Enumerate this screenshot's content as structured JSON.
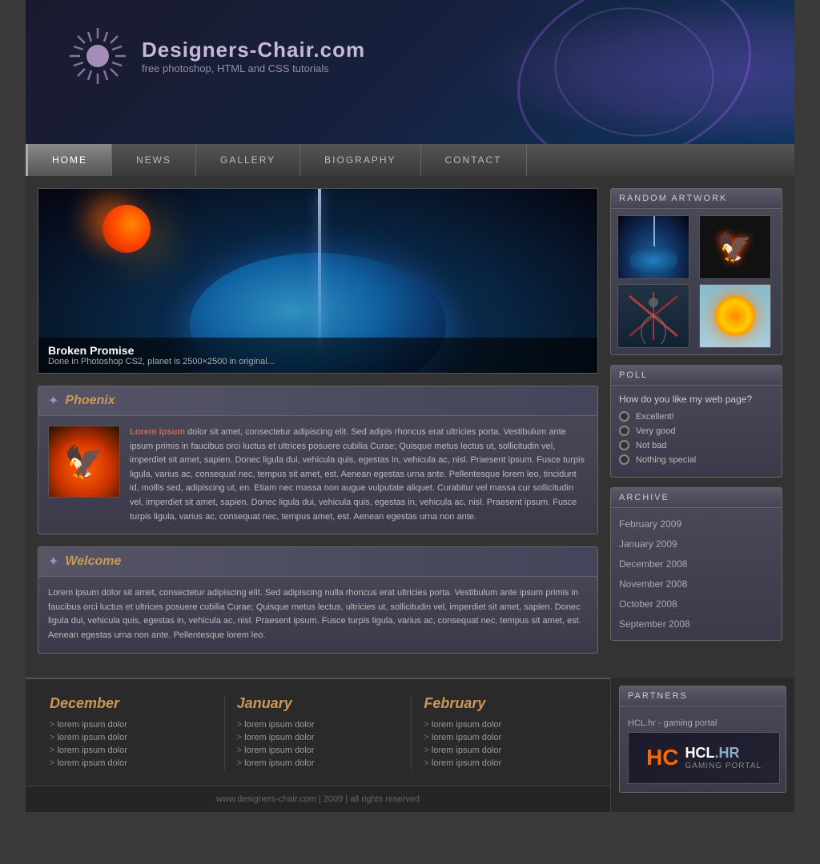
{
  "site": {
    "title": "Designers-Chair.com",
    "subtitle": "free photoshop, HTML and CSS tutorials"
  },
  "nav": {
    "items": [
      {
        "label": "HOME",
        "active": true
      },
      {
        "label": "NEWS",
        "active": false
      },
      {
        "label": "GALLERY",
        "active": false
      },
      {
        "label": "BIOGRAPHY",
        "active": false
      },
      {
        "label": "CONTACT",
        "active": false
      }
    ]
  },
  "featured": {
    "title": "Broken Promise",
    "caption": "Done in Photoshop CS2, planet is 2500×2500 in original..."
  },
  "posts": [
    {
      "title": "Phoenix",
      "lorem_title": "Lorem ipsum",
      "body": "dolor sit amet, consectetur adipiscing elit. Sed adipis rhoncus erat ultricies porta. Vestibulum ante ipsum primis in faucibus orci luctus et ultrices posuere cubilia Curae; Quisque metus lectus ut, sollicitudin vel, imperdiet sit amet, sapien. Donec ligula dui, vehicula quis, egestas in, vehicula ac, nisl. Praesent ipsum. Fusce turpis ligula, varius ac, consequat nec, tempus sit amet, est. Aenean egestas urna ante. Pellentesque lorem leo, tincidunt id, mollis sed, adipiscing ut, en. Etiam nec massa non augue vulputate aliquet. Curabitur vel massa cur sollicitudin vel, imperdiet sit amet, sapien. Donec ligula dui, vehicula quis, egestas in, vehicula ac, nisl. Praesent ipsum. Fusce turpis ligula, varius ac, consequat nec, tempus amet, est. Aenean egestas urna non ante."
    },
    {
      "title": "Welcome",
      "lorem_title": "Lorem ipsum",
      "body": "dolor sit amet, consectetur adipiscing elit. Sed adipiscing nulla rhoncus erat ultricies porta. Vestibulum ante ipsum primis in faucibus orci luctus et ultrices posuere cubilia Curae; Quisque metus lectus, ultricies ut, sollicitudin vel, imperdiet sit amet, sapien. Donec ligula dui, vehicula quis, egestas in, vehicula ac, nisl. Praesent ipsum. Fusce turpis ligula, varius ac, consequat nec, tempus sit amet, est. Aenean egestas urna non ante. Pellentesque lorem leo."
    }
  ],
  "sidebar": {
    "artwork_title": "RANDOM ARTWORK",
    "poll_title": "POLL",
    "poll_question": "How do you like my web page?",
    "poll_options": [
      {
        "label": "Excellent!"
      },
      {
        "label": "Very good"
      },
      {
        "label": "Not bad"
      },
      {
        "label": "Nothing special"
      }
    ],
    "archive_title": "ARCHIVE",
    "archive_items": [
      {
        "label": "February 2009"
      },
      {
        "label": "January 2009"
      },
      {
        "label": "December 2008"
      },
      {
        "label": "November 2008"
      },
      {
        "label": "October 2008"
      },
      {
        "label": "September 2008"
      }
    ]
  },
  "footer": {
    "cols": [
      {
        "title": "December",
        "links": [
          "lorem ipsum dolor",
          "lorem ipsum dolor",
          "lorem ipsum dolor",
          "lorem ipsum dolor"
        ]
      },
      {
        "title": "January",
        "links": [
          "lorem ipsum dolor",
          "lorem ipsum dolor",
          "lorem ipsum dolor",
          "lorem ipsum dolor"
        ]
      },
      {
        "title": "February",
        "links": [
          "lorem ipsum dolor",
          "lorem ipsum dolor",
          "lorem ipsum dolor",
          "lorem ipsum dolor"
        ]
      }
    ],
    "partners_title": "PARTNERS",
    "partners_link": "HCL.hr - gaming portal",
    "copyright": "www.designers-chair.com | 2009 | all rights reserved"
  }
}
